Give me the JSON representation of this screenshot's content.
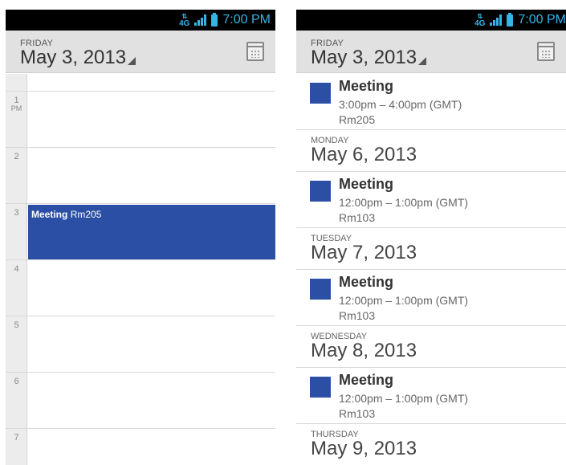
{
  "status_bar": {
    "network": "4G",
    "time": "7:00 PM"
  },
  "left": {
    "header": {
      "day": "FRIDAY",
      "date": "May 3, 2013"
    },
    "hours": [
      {
        "num": "1",
        "ampm": "PM"
      },
      {
        "num": "2",
        "ampm": ""
      },
      {
        "num": "3",
        "ampm": ""
      },
      {
        "num": "4",
        "ampm": ""
      },
      {
        "num": "5",
        "ampm": ""
      },
      {
        "num": "6",
        "ampm": ""
      },
      {
        "num": "7",
        "ampm": ""
      }
    ],
    "event": {
      "title": "Meeting",
      "location": "Rm205"
    }
  },
  "right": {
    "header": {
      "day": "FRIDAY",
      "date": "May 3, 2013"
    },
    "events": [
      {
        "title": "Meeting",
        "time": "3:00pm – 4:00pm (GMT)",
        "location": "Rm205"
      },
      {
        "title": "Meeting",
        "time": "12:00pm – 1:00pm (GMT)",
        "location": "Rm103"
      },
      {
        "title": "Meeting",
        "time": "12:00pm – 1:00pm (GMT)",
        "location": "Rm103"
      },
      {
        "title": "Meeting",
        "time": "12:00pm – 1:00pm (GMT)",
        "location": "Rm103"
      }
    ],
    "days": [
      {
        "name": "MONDAY",
        "date": "May 6, 2013"
      },
      {
        "name": "TUESDAY",
        "date": "May 7, 2013"
      },
      {
        "name": "WEDNESDAY",
        "date": "May 8, 2013"
      },
      {
        "name": "THURSDAY",
        "date": "May 9, 2013"
      }
    ]
  },
  "colors": {
    "accent": "#33b5e5",
    "event": "#2a4fa5"
  }
}
